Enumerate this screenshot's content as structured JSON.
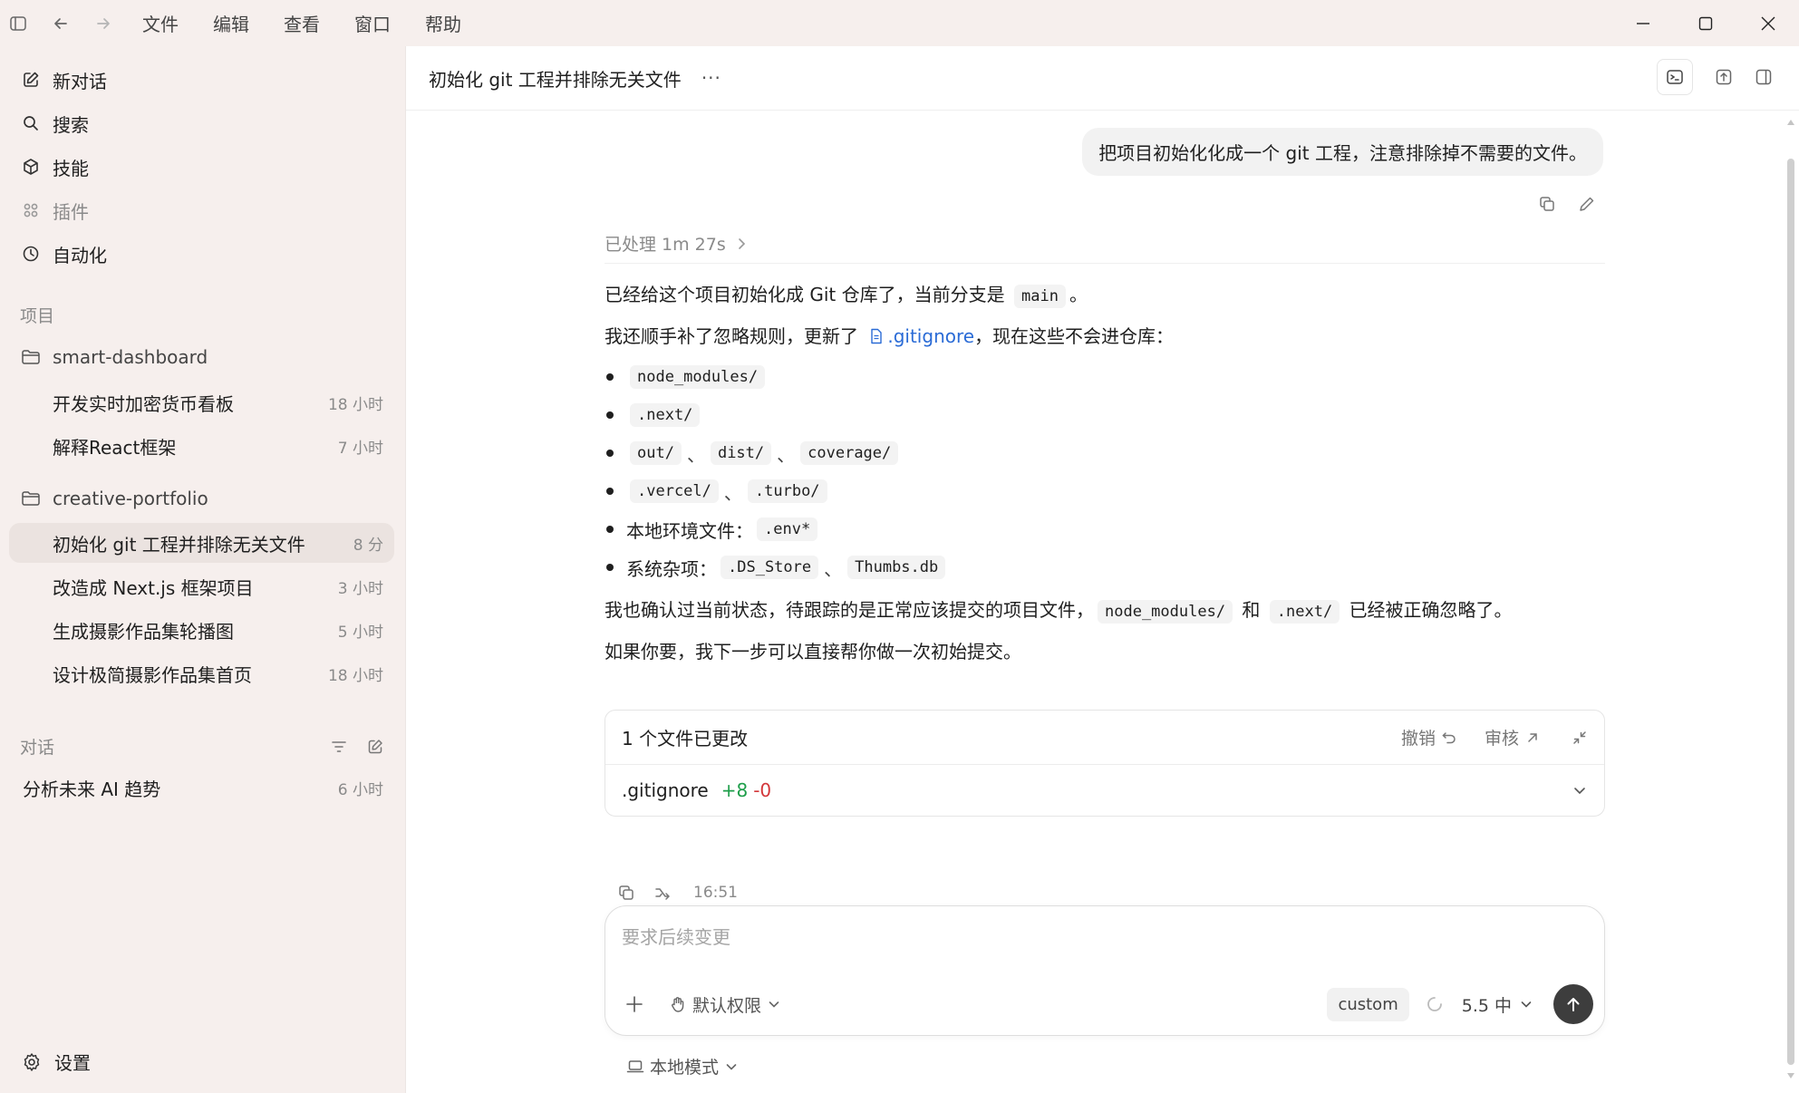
{
  "menu": [
    "文件",
    "编辑",
    "查看",
    "窗口",
    "帮助"
  ],
  "sidebar": {
    "nav": [
      {
        "label": "新对话",
        "icon": "new-chat-icon"
      },
      {
        "label": "搜索",
        "icon": "search-icon"
      },
      {
        "label": "技能",
        "icon": "skills-icon"
      },
      {
        "label": "插件",
        "icon": "plugins-icon"
      },
      {
        "label": "自动化",
        "icon": "clock-icon"
      }
    ],
    "projects_label": "项目",
    "projects": [
      {
        "name": "smart-dashboard",
        "threads": [
          {
            "title": "开发实时加密货币看板",
            "time": "18 小时"
          },
          {
            "title": "解释React框架",
            "time": "7 小时"
          }
        ]
      },
      {
        "name": "creative-portfolio",
        "threads": [
          {
            "title": "初始化 git 工程并排除无关文件",
            "time": "8 分"
          },
          {
            "title": "改造成 Next.js 框架项目",
            "time": "3 小时"
          },
          {
            "title": "生成摄影作品集轮播图",
            "time": "5 小时"
          },
          {
            "title": "设计极简摄影作品集首页",
            "time": "18 小时"
          }
        ]
      }
    ],
    "conversations_label": "对话",
    "conversations": [
      {
        "title": "分析未来 AI 趋势",
        "time": "6 小时"
      }
    ],
    "settings_label": "设置"
  },
  "header": {
    "title": "初始化 git 工程并排除无关文件",
    "more": "···"
  },
  "user_message": "把项目初始化化成一个 git 工程，注意排除掉不需要的文件。",
  "assistant": {
    "processed": "已处理 1m 27s",
    "p1_text": "已经给这个项目初始化成 Git 仓库了，当前分支是",
    "p1_code": "main",
    "p1_end": "。",
    "p2_text": "我还顺手补了忽略规则，更新了",
    "p2_link": ".gitignore",
    "p2_end": "，现在这些不会进仓库：",
    "b1": "node_modules/",
    "b2": ".next/",
    "b3a": "out/",
    "b3b": "dist/",
    "b3c": "coverage/",
    "b4a": ".vercel/",
    "b4b": ".turbo/",
    "b5_label": "本地环境文件：",
    "b5_code": ".env*",
    "b6_label": "系统杂项：",
    "b6a": ".DS_Store",
    "b6b": "Thumbs.db",
    "sep": "、",
    "p3_a": "我也确认过当前状态，待跟踪的是正常应该提交的项目文件，",
    "p3_code1": "node_modules/",
    "p3_mid": "和",
    "p3_code2": ".next/",
    "p3_end": "已经被正确忽略了。",
    "p4": "如果你要，我下一步可以直接帮你做一次初始提交。"
  },
  "changes": {
    "title": "1 个文件已更改",
    "undo": "撤销",
    "review": "审核",
    "file": ".gitignore",
    "additions": "+8",
    "deletions": "-0"
  },
  "message_time": "16:51",
  "composer": {
    "placeholder": "要求后续变更",
    "permissions": "默认权限",
    "custom": "custom",
    "model": "5.5 中"
  },
  "local_mode": "本地模式"
}
